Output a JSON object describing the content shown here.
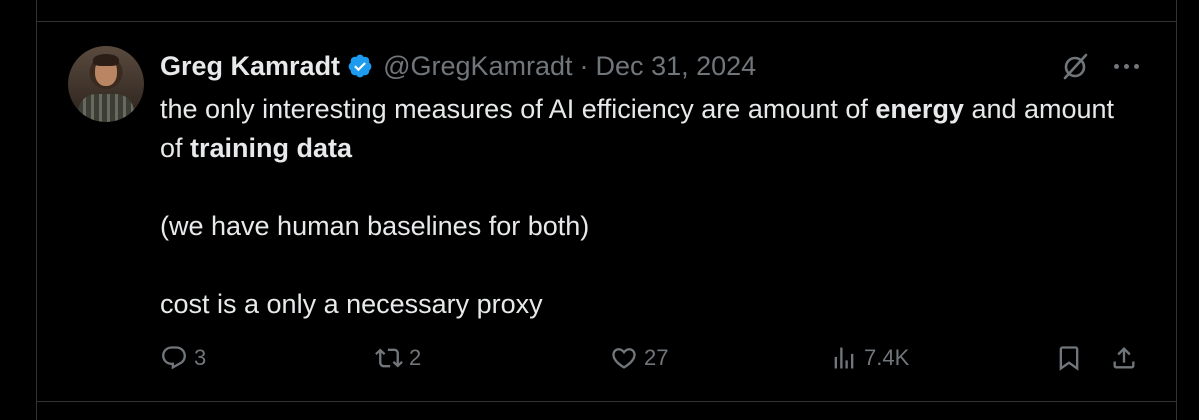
{
  "tweet": {
    "author_name": "Greg Kamradt",
    "handle": "@GregKamradt",
    "separator": "·",
    "date": "Dec 31, 2024",
    "text_part1": "the only interesting measures of AI efficiency are amount of ",
    "text_bold1": "energy",
    "text_part2": " and amount of ",
    "text_bold2": "training data",
    "text_line2": "(we have human baselines for both)",
    "text_line3": "cost is a only a necessary proxy"
  },
  "stats": {
    "replies": "3",
    "reposts": "2",
    "likes": "27",
    "views": "7.4K"
  },
  "colors": {
    "background": "#000000",
    "text": "#e7e9ea",
    "muted": "#71767b",
    "verified": "#1d9bf0",
    "border": "#2f3336"
  },
  "icons": [
    "verified-badge-icon",
    "grok-icon",
    "more-icon",
    "reply-icon",
    "repost-icon",
    "like-icon",
    "views-icon",
    "bookmark-icon",
    "share-icon"
  ]
}
